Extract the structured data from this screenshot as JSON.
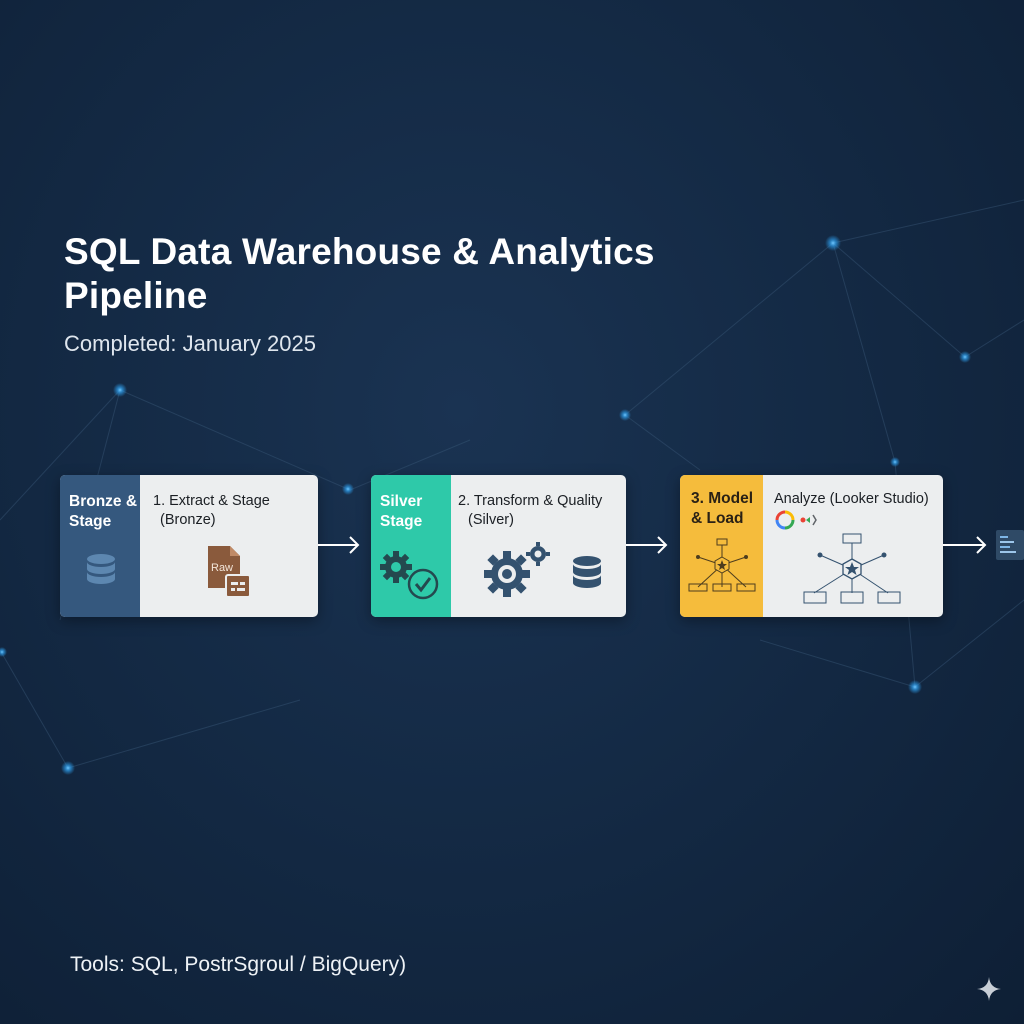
{
  "title": "SQL Data Warehouse & Analytics Pipeline",
  "subtitle": "Completed: January 2025",
  "tools": "Tools: SQL, PostrSgroul / BigQuery)",
  "colors": {
    "background": "#142a45",
    "bronze": "#35587e",
    "silver": "#2ec9a9",
    "gold": "#f5bc3c",
    "card": "#eceeef",
    "icon": "#4a6a8a"
  },
  "cards": [
    {
      "strip_label": "Bronze & Stage",
      "label_line1": "1. Extract & Stage",
      "label_line2": "(Bronze)",
      "icons": [
        "database-icon",
        "raw-file-icon"
      ],
      "file_text": "Raw"
    },
    {
      "strip_label": "Silver Stage",
      "label_line1": "2. Transform & Quality",
      "label_line2": "(Silver)",
      "icons": [
        "gear-check-icon",
        "gears-icon",
        "database-icon"
      ]
    },
    {
      "strip_label": "3. Model & Load",
      "label_line1": "Analyze (Looker Studio)",
      "icons": [
        "looker-studio-icon",
        "star-schema-icon"
      ]
    }
  ]
}
